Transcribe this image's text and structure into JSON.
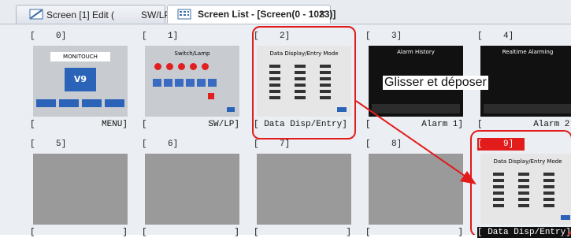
{
  "tabs": [
    {
      "label": "Screen [1] Edit (",
      "suffix": "SW/LP)",
      "icon": "edit-screen-icon"
    },
    {
      "label": "Screen List - [Screen(0 - 1023)]",
      "icon": "screen-list-icon",
      "close": "×"
    }
  ],
  "cells": [
    {
      "num": "[    0]",
      "name_left": "[",
      "name_right": "MENU]",
      "thumb": "menu",
      "thumb_title": "MONITOUCH",
      "thumb_logo": "V9"
    },
    {
      "num": "[    1]",
      "name_left": "[",
      "name_right": "SW/LP]",
      "thumb": "switch",
      "thumb_title": "Switch/Lamp"
    },
    {
      "num": "[    2]",
      "name_left": "[ Data Disp/Entry]",
      "name_right": "",
      "thumb": "data",
      "thumb_title": "Data Display/Entry Mode"
    },
    {
      "num": "[    3]",
      "name_left": "[",
      "name_right": "Alarm 1]",
      "thumb": "alarm",
      "thumb_title": "Alarm History"
    },
    {
      "num": "[    4]",
      "name_left": "[",
      "name_right": "Alarm 2]",
      "thumb": "alarm",
      "thumb_title": "Realtime Alarming"
    },
    {
      "num": "[    5]",
      "name_left": "[",
      "name_right": "]",
      "thumb": "empty"
    },
    {
      "num": "[    6]",
      "name_left": "[",
      "name_right": "]",
      "thumb": "empty"
    },
    {
      "num": "[    7]",
      "name_left": "[",
      "name_right": "]",
      "thumb": "empty"
    },
    {
      "num": "[    8]",
      "name_left": "[",
      "name_right": "]",
      "thumb": "empty"
    },
    {
      "num": "[    9]",
      "name_left": "[ Data Disp/Entry]",
      "name_right": "",
      "thumb": "data",
      "thumb_title": "Data Display/Entry Mode"
    }
  ],
  "annotation": {
    "label": "Glisser et déposer",
    "color": "#e21b1b"
  }
}
